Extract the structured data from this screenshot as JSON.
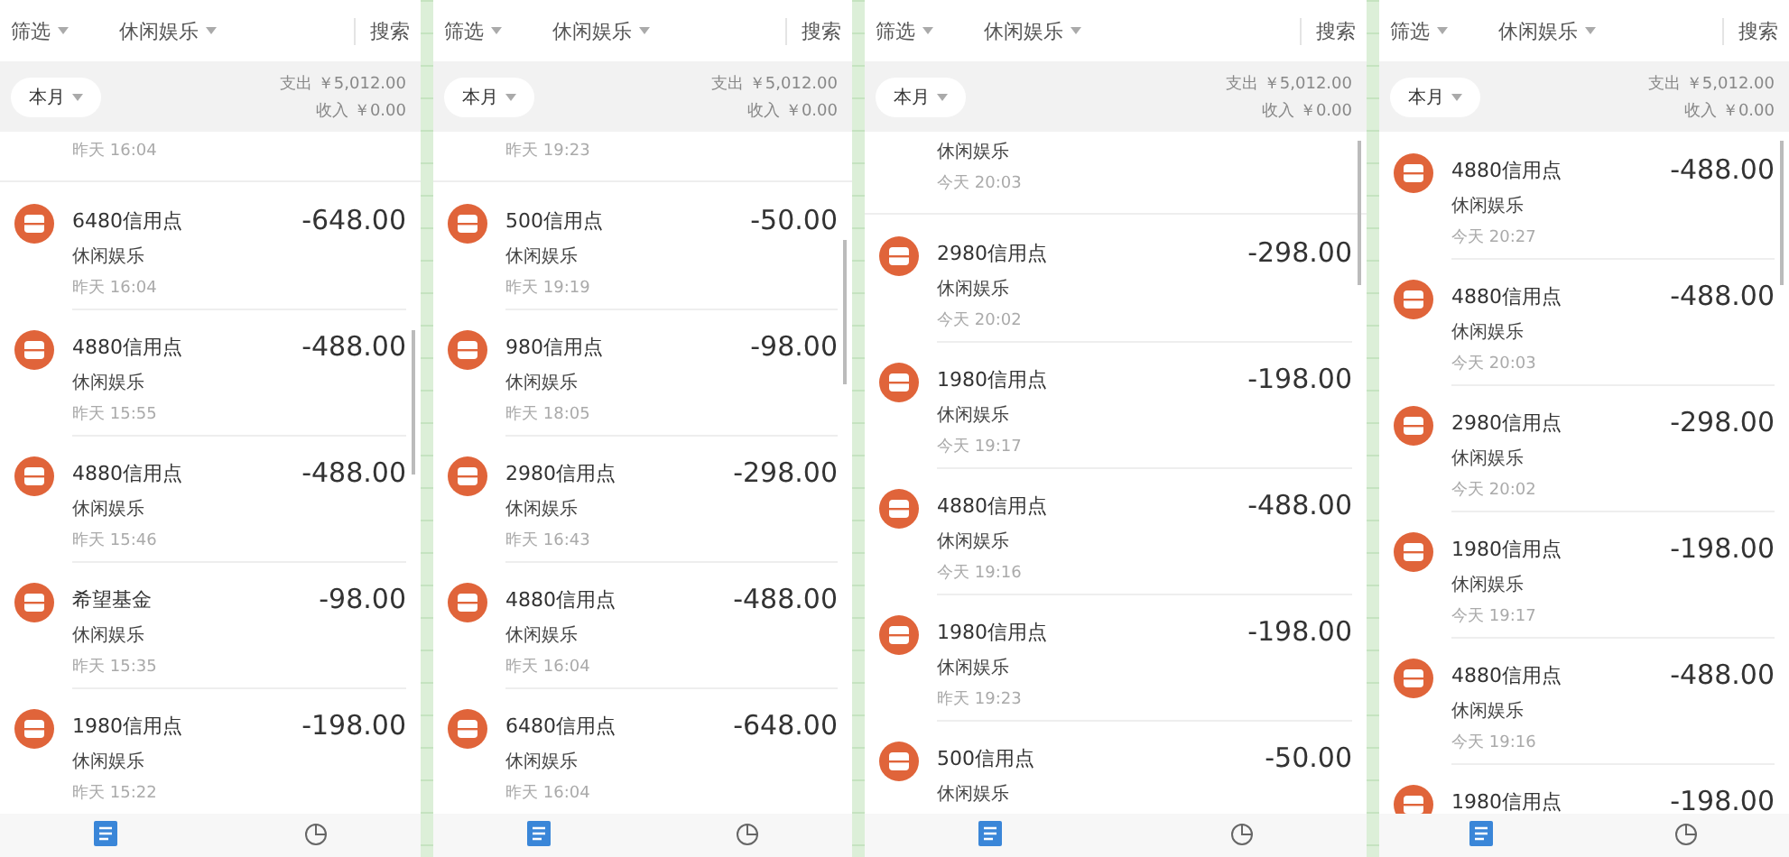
{
  "panels": [
    {
      "filter": "筛选",
      "category": "休闲娱乐",
      "search": "搜索",
      "period": "本月",
      "expense": "支出 ￥5,012.00",
      "income": "收入 ￥0.00",
      "top_partial": {
        "time": "昨天 16:04"
      },
      "items": [
        {
          "title": "6480信用点",
          "category": "休闲娱乐",
          "time": "昨天 16:04",
          "amount": "-648.00"
        },
        {
          "title": "4880信用点",
          "category": "休闲娱乐",
          "time": "昨天 15:55",
          "amount": "-488.00"
        },
        {
          "title": "4880信用点",
          "category": "休闲娱乐",
          "time": "昨天 15:46",
          "amount": "-488.00"
        },
        {
          "title": "希望基金",
          "category": "休闲娱乐",
          "time": "昨天 15:35",
          "amount": "-98.00"
        },
        {
          "title": "1980信用点",
          "category": "休闲娱乐",
          "time": "昨天 15:22",
          "amount": "-198.00"
        }
      ]
    },
    {
      "filter": "筛选",
      "category": "休闲娱乐",
      "search": "搜索",
      "period": "本月",
      "expense": "支出 ￥5,012.00",
      "income": "收入 ￥0.00",
      "top_partial": {
        "time": "昨天 19:23"
      },
      "items": [
        {
          "title": "500信用点",
          "category": "休闲娱乐",
          "time": "昨天 19:19",
          "amount": "-50.00"
        },
        {
          "title": "980信用点",
          "category": "休闲娱乐",
          "time": "昨天 18:05",
          "amount": "-98.00"
        },
        {
          "title": "2980信用点",
          "category": "休闲娱乐",
          "time": "昨天 16:43",
          "amount": "-298.00"
        },
        {
          "title": "4880信用点",
          "category": "休闲娱乐",
          "time": "昨天 16:04",
          "amount": "-488.00"
        },
        {
          "title": "6480信用点",
          "category": "休闲娱乐",
          "time": "昨天 16:04",
          "amount": "-648.00"
        }
      ]
    },
    {
      "filter": "筛选",
      "category": "休闲娱乐",
      "search": "搜索",
      "period": "本月",
      "expense": "支出 ￥5,012.00",
      "income": "收入 ￥0.00",
      "top_partial": {
        "category": "休闲娱乐",
        "time": "今天 20:03"
      },
      "items": [
        {
          "title": "2980信用点",
          "category": "休闲娱乐",
          "time": "今天 20:02",
          "amount": "-298.00"
        },
        {
          "title": "1980信用点",
          "category": "休闲娱乐",
          "time": "今天 19:17",
          "amount": "-198.00"
        },
        {
          "title": "4880信用点",
          "category": "休闲娱乐",
          "time": "今天 19:16",
          "amount": "-488.00"
        },
        {
          "title": "1980信用点",
          "category": "休闲娱乐",
          "time": "昨天 19:23",
          "amount": "-198.00"
        },
        {
          "title": "500信用点",
          "category": "休闲娱乐",
          "amount": "-50.00"
        }
      ]
    },
    {
      "filter": "筛选",
      "category": "休闲娱乐",
      "search": "搜索",
      "period": "本月",
      "expense": "支出 ￥5,012.00",
      "income": "收入 ￥0.00",
      "items": [
        {
          "title": "4880信用点",
          "category": "休闲娱乐",
          "time": "今天 20:27",
          "amount": "-488.00"
        },
        {
          "title": "4880信用点",
          "category": "休闲娱乐",
          "time": "今天 20:03",
          "amount": "-488.00"
        },
        {
          "title": "2980信用点",
          "category": "休闲娱乐",
          "time": "今天 20:02",
          "amount": "-298.00"
        },
        {
          "title": "1980信用点",
          "category": "休闲娱乐",
          "time": "今天 19:17",
          "amount": "-198.00"
        },
        {
          "title": "4880信用点",
          "category": "休闲娱乐",
          "time": "今天 19:16",
          "amount": "-488.00"
        },
        {
          "title": "1980信用点",
          "amount": "-198.00"
        }
      ]
    }
  ]
}
